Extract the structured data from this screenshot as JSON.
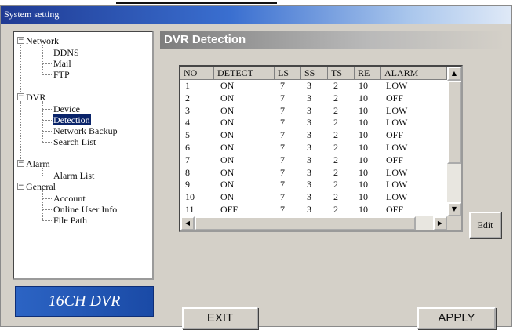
{
  "window": {
    "title": "System setting"
  },
  "tree": {
    "groups": [
      {
        "label": "Network",
        "children": [
          "DDNS",
          "Mail",
          "FTP"
        ]
      },
      {
        "label": "DVR",
        "children": [
          "Device",
          "Detection",
          "Network Backup",
          "Search List"
        ]
      },
      {
        "label": "Alarm",
        "children": [
          "Alarm List"
        ]
      },
      {
        "label": "General",
        "children": [
          "Account",
          "Online User Info",
          "File Path"
        ]
      }
    ],
    "selected": "Detection",
    "expanded_symbol": "−"
  },
  "logo": {
    "text": "16CH DVR"
  },
  "section": {
    "title": "DVR Detection"
  },
  "table": {
    "columns": [
      "NO",
      "DETECT",
      "LS",
      "SS",
      "TS",
      "RE",
      "ALARM"
    ],
    "rows": [
      [
        "1",
        "ON",
        "7",
        "3",
        "2",
        "10",
        "LOW"
      ],
      [
        "2",
        "ON",
        "7",
        "3",
        "2",
        "10",
        "OFF"
      ],
      [
        "3",
        "ON",
        "7",
        "3",
        "2",
        "10",
        "LOW"
      ],
      [
        "4",
        "ON",
        "7",
        "3",
        "2",
        "10",
        "LOW"
      ],
      [
        "5",
        "ON",
        "7",
        "3",
        "2",
        "10",
        "OFF"
      ],
      [
        "6",
        "ON",
        "7",
        "3",
        "2",
        "10",
        "LOW"
      ],
      [
        "7",
        "ON",
        "7",
        "3",
        "2",
        "10",
        "OFF"
      ],
      [
        "8",
        "ON",
        "7",
        "3",
        "2",
        "10",
        "LOW"
      ],
      [
        "9",
        "ON",
        "7",
        "3",
        "2",
        "10",
        "LOW"
      ],
      [
        "10",
        "ON",
        "7",
        "3",
        "2",
        "10",
        "LOW"
      ],
      [
        "11",
        "OFF",
        "7",
        "3",
        "2",
        "10",
        "OFF"
      ]
    ]
  },
  "buttons": {
    "edit": "Edit",
    "exit": "EXIT",
    "apply": "APPLY"
  },
  "colors": {
    "titlebar": "#1f3a93",
    "selection": "#0a246a",
    "logo": "#2c64c4",
    "face": "#d4d0c8"
  }
}
